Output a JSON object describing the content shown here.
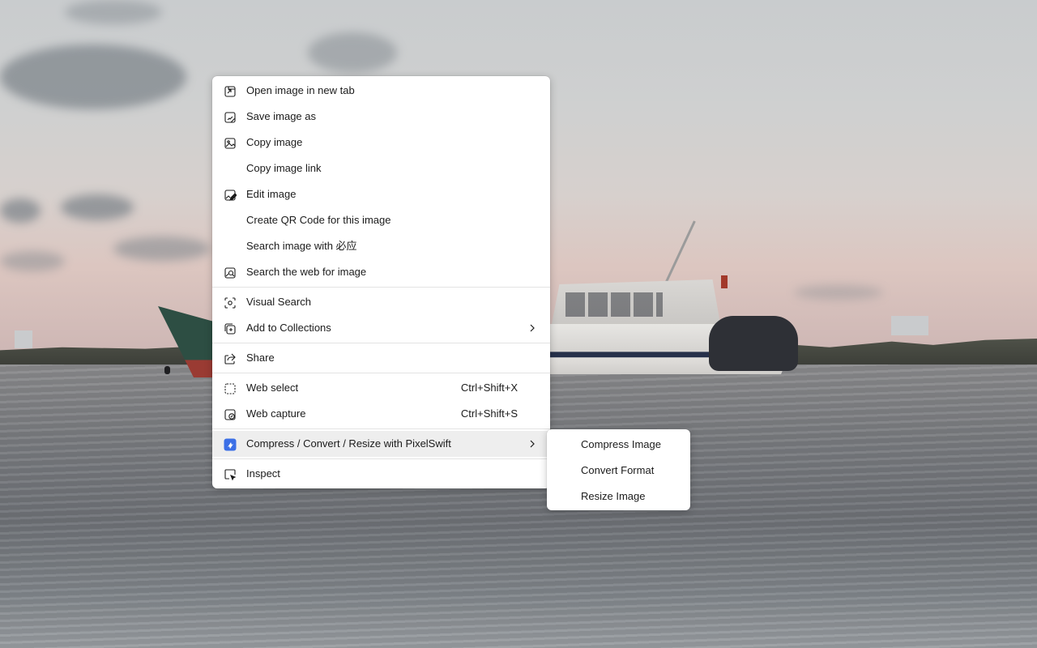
{
  "context_menu": {
    "items": [
      {
        "label": "Open image in new tab",
        "icon": "open-in-new-tab-icon"
      },
      {
        "label": "Save image as",
        "icon": "save-image-icon"
      },
      {
        "label": "Copy image",
        "icon": "copy-image-icon"
      },
      {
        "label": "Copy image link",
        "icon": ""
      },
      {
        "label": "Edit image",
        "icon": "edit-image-icon"
      },
      {
        "label": "Create QR Code for this image",
        "icon": ""
      },
      {
        "label": "Search image with 必应",
        "icon": ""
      },
      {
        "label": "Search the web for image",
        "icon": "search-web-image-icon"
      },
      {
        "label": "Visual Search",
        "icon": "visual-search-icon"
      },
      {
        "label": "Add to Collections",
        "icon": "collections-icon",
        "has_submenu": true
      },
      {
        "label": "Share",
        "icon": "share-icon"
      },
      {
        "label": "Web select",
        "icon": "web-select-icon",
        "shortcut": "Ctrl+Shift+X"
      },
      {
        "label": "Web capture",
        "icon": "web-capture-icon",
        "shortcut": "Ctrl+Shift+S"
      },
      {
        "label": "Compress / Convert / Resize with PixelSwift",
        "icon": "pixelswift-extension-icon",
        "has_submenu": true,
        "active": true
      },
      {
        "label": "Inspect",
        "icon": "inspect-icon"
      }
    ]
  },
  "submenu": {
    "items": [
      {
        "label": "Compress Image"
      },
      {
        "label": "Convert Format"
      },
      {
        "label": "Resize Image"
      }
    ]
  },
  "colors": {
    "menu_background": "#ffffff",
    "active_item": "#eeeeee",
    "separator": "#e3e3e3",
    "text": "#1b1b1b",
    "pixelswift_accent": "#3b6fe6"
  }
}
